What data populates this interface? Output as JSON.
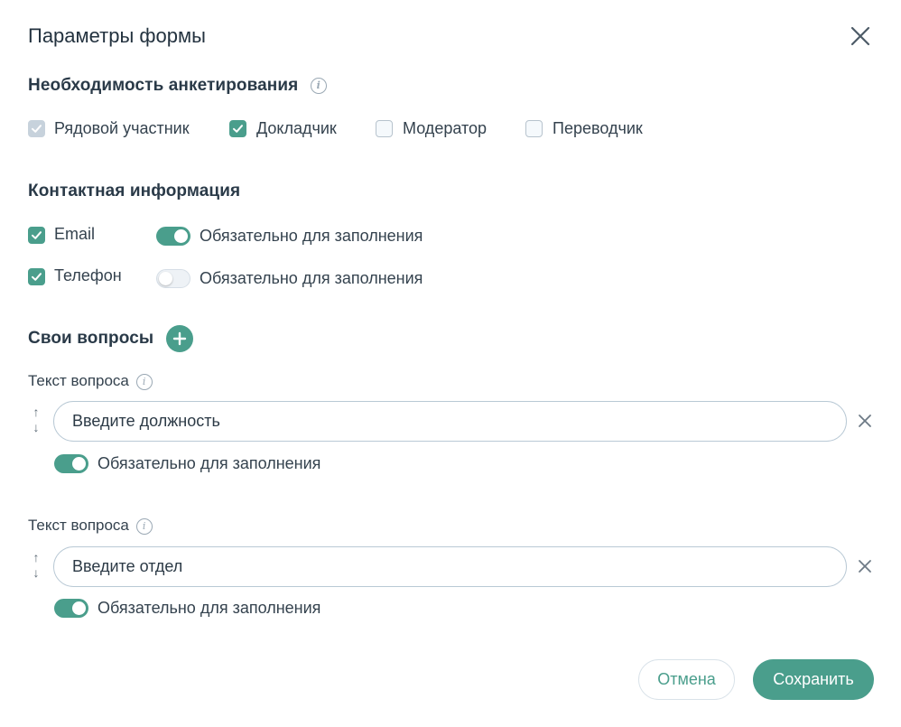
{
  "dialog": {
    "title": "Параметры формы"
  },
  "survey": {
    "title": "Необходимость анкетирования",
    "info_icon": "i",
    "options": [
      {
        "label": "Рядовой участник",
        "state": "checked-disabled"
      },
      {
        "label": "Докладчик",
        "state": "checked"
      },
      {
        "label": "Модератор",
        "state": "unchecked"
      },
      {
        "label": "Переводчик",
        "state": "unchecked"
      }
    ]
  },
  "contact": {
    "title": "Контактная информация",
    "rows": [
      {
        "label": "Email",
        "checked": true,
        "required_label": "Обязательно для заполнения",
        "required": true
      },
      {
        "label": "Телефон",
        "checked": true,
        "required_label": "Обязательно для заполнения",
        "required": false
      }
    ]
  },
  "questions": {
    "title": "Свои вопросы",
    "items": [
      {
        "label": "Текст вопроса",
        "value": "Введите должность",
        "required_label": "Обязательно для заполнения",
        "required": true
      },
      {
        "label": "Текст вопроса",
        "value": "Введите отдел",
        "required_label": "Обязательно для заполнения",
        "required": true
      }
    ]
  },
  "footer": {
    "cancel_label": "Отмена",
    "save_label": "Сохранить"
  },
  "colors": {
    "accent": "#4a9e8c",
    "text": "#2c3e4c",
    "border": "#b9c9d5"
  },
  "icons": {
    "close": "close-icon",
    "info": "info-icon",
    "check": "check-icon",
    "add": "plus-icon",
    "reorder": "up-down-arrows-icon",
    "delete": "x-icon"
  }
}
